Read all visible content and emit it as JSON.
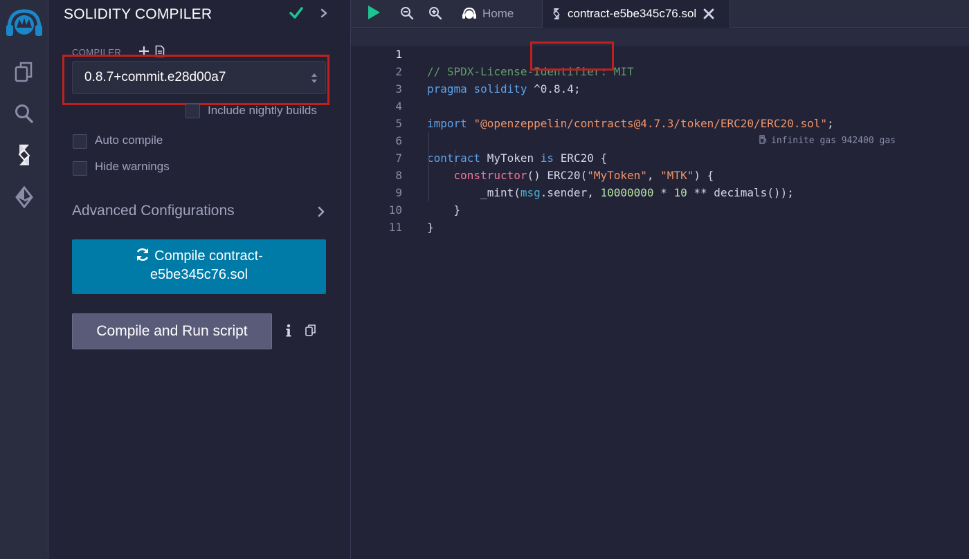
{
  "sidebar": {
    "icons": [
      "remix-logo-icon",
      "file-explorer-icon",
      "search-icon",
      "solidity-compiler-icon",
      "deploy-run-icon"
    ]
  },
  "panel": {
    "title": "SOLIDITY COMPILER",
    "compiler_label": "COMPILER",
    "compiler_version": "0.8.7+commit.e28d00a7",
    "nightly_label": "Include nightly builds",
    "auto_compile_label": "Auto compile",
    "hide_warnings_label": "Hide warnings",
    "advanced_label": "Advanced Configurations",
    "compile_button_line1": "Compile contract-",
    "compile_button_line2": "e5be345c76.sol",
    "run_button": "Compile and Run script"
  },
  "tabs": {
    "home": "Home",
    "contract": "contract-e5be345c76.sol"
  },
  "editor": {
    "line_numbers": [
      "1",
      "2",
      "3",
      "4",
      "5",
      "6",
      "7",
      "8",
      "9",
      "10",
      "11"
    ],
    "l1_comment": "// SPDX-License-Identifier: MIT",
    "l2_pragma": "pragma",
    "l2_solidity": "solidity",
    "l2_version": "^0.8.4",
    "l2_semicolon": ";",
    "l4_import": "import",
    "l4_path": "\"@openzeppelin/contracts@4.7.3/token/ERC20/ERC20.sol\"",
    "l4_semicolon": ";",
    "l6_contract": "contract",
    "l6_name": "MyToken",
    "l6_is": "is",
    "l6_base": "ERC20 {",
    "l7_constructor": "constructor",
    "l7_parens": "() ERC20(",
    "l7_str1": "\"MyToken\"",
    "l7_comma": ", ",
    "l7_str2": "\"MTK\"",
    "l7_end": ") {",
    "l7_gas": "infinite gas 942400 gas",
    "l8_mint": "_mint(",
    "l8_msg": "msg",
    "l8_sender": ".sender, ",
    "l8_num1": "10000000",
    "l8_op": " * ",
    "l8_num2": "10",
    "l8_rest": " ** decimals());",
    "l9": "}",
    "l10": "}"
  },
  "colors": {
    "accent": "#007aa6",
    "highlight_box": "#c0211e",
    "success": "#1cc492"
  }
}
